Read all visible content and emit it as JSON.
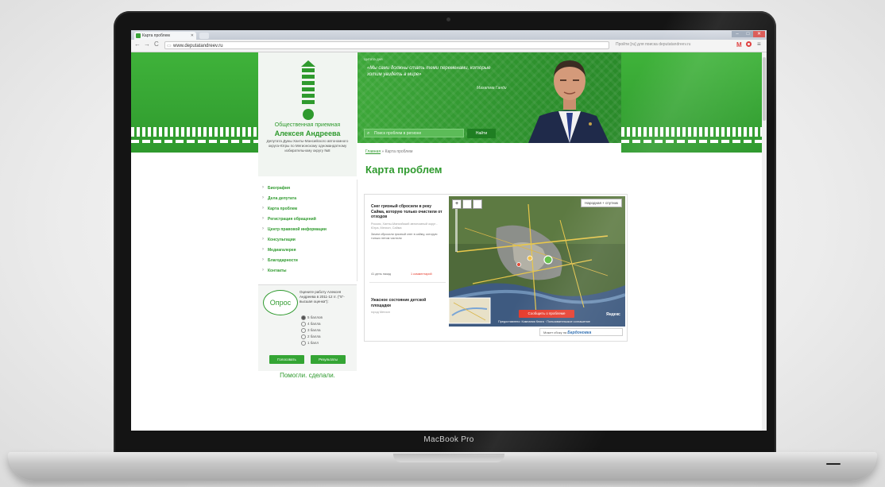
{
  "device": {
    "brand_label": "MacBook Pro"
  },
  "browser": {
    "tab_title": "Карта проблем",
    "url": "www.deputatandreev.ru",
    "ext_text": "Пройти [ru]  для поиска deputatandreev.ru",
    "nav": {
      "back": "←",
      "forward": "→",
      "reload": "C"
    }
  },
  "site": {
    "org_line1": "Общественная приемная",
    "org_line2": "Алексея Андреева",
    "org_line3": "Депутата Думы Ханты-Мансийского автономного округа-Югры по Мегионскому одномандатному избирательному округу №8",
    "quote_label": "Цитата дня",
    "quote": "«Мы сами должны стать теми переменами, которые хотим увидеть в мире»",
    "quote_author": "Махатма Ганди",
    "search_placeholder": "Поиск проблем в регионе",
    "search_button": "Найти",
    "breadcrumb_home": "Главная",
    "breadcrumb_sep": "»",
    "breadcrumb_current": "Карта проблем",
    "page_title": "Карта проблем"
  },
  "menu": [
    "Биография",
    "Дела депутата",
    "Карта проблем",
    "Регистрация обращений",
    "Центр правовой информации",
    "Консультации",
    "Медиагалерея",
    "Благодарности",
    "Контакты"
  ],
  "poll": {
    "badge": "Опрос",
    "question": "Оцените работу Алексея Андреева в 2011-12 гг. (\"5\"-высшая оценка\"):",
    "options": [
      "5 баллов",
      "4 балла",
      "3 балла",
      "2 балла",
      "1 балл"
    ],
    "vote_button": "Голосовать",
    "results_button": "Результаты"
  },
  "helped_text": "Помогли. сделали.",
  "issues": [
    {
      "title": "Снег грязный сбросили в реку Сайма, которую только очистили от отходов",
      "location": "Россия, Ханты-Мансийский автономный округ - Югра, Мегион, Сайма",
      "desc": "Зачем сбросили грязный снег в сайму, которую только летом чистили",
      "time": "41 день назад",
      "comments": "1 комментарий"
    },
    {
      "title": "Ужасное состояние детской площадки",
      "location": "город Мегион",
      "desc": "",
      "time": "",
      "comments": ""
    }
  ],
  "map": {
    "type_select": "Народная + спутник",
    "report_button": "Сообщить о проблеме",
    "footer_text": "Предоставлено: Компания Книга · Пользовательское соглашение",
    "provider": "Яндекс",
    "powered_prefix": "Может сбоку на",
    "powered_brand": "Бардоновка"
  },
  "colors": {
    "brand_green": "#2f9a2e",
    "accent_red": "#e53a2b"
  }
}
